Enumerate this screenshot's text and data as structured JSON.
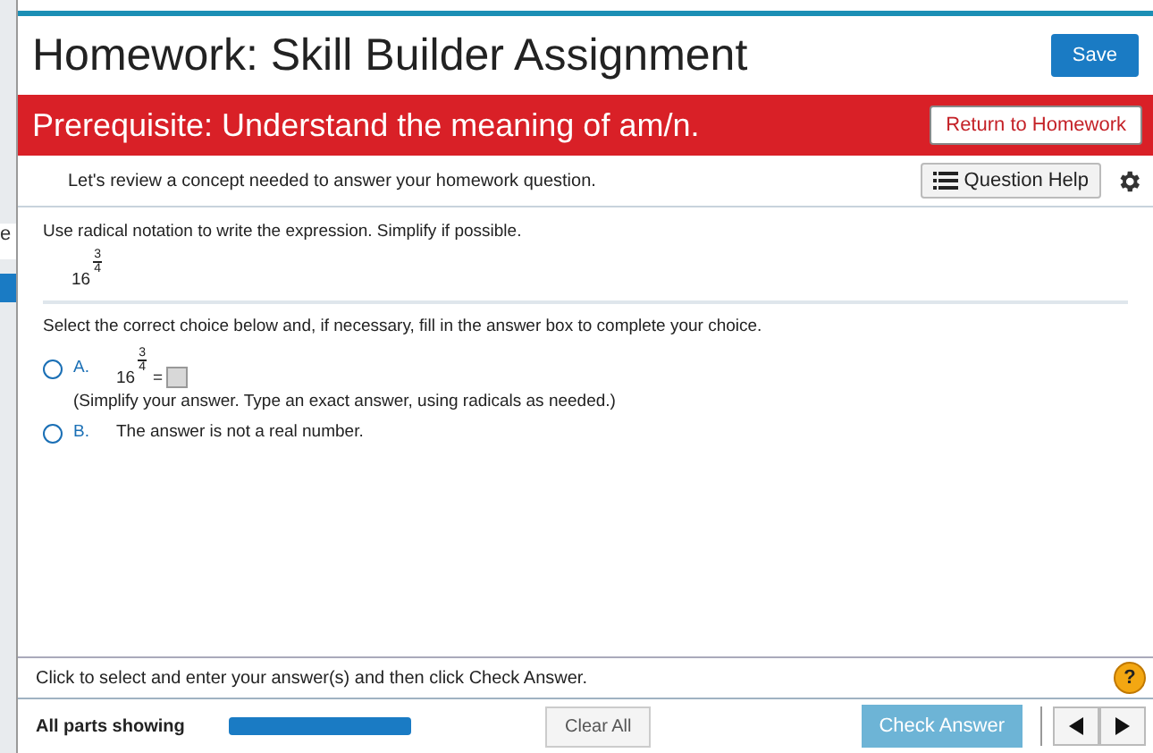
{
  "background_window": {
    "text": "e"
  },
  "header": {
    "title": "Homework: Skill Builder Assignment",
    "save_button": "Save"
  },
  "banner": {
    "text": "Prerequisite: Understand the meaning of am/n.",
    "button": "Return to Homework"
  },
  "toolbar": {
    "text": "Let's review a concept needed to answer your homework question.",
    "help_button": "Question Help"
  },
  "question": {
    "instruction": "Use radical notation to write the expression. Simplify if possible.",
    "base": "16",
    "numerator": "3",
    "denominator": "4",
    "prompt": "Select the correct choice below and, if necessary, fill in the answer box to complete your choice.",
    "choices": [
      {
        "kind": "answer",
        "letter": "A.",
        "selected": false,
        "base": "16",
        "numerator": "3",
        "denominator": "4",
        "equals": "=",
        "hint": "(Simplify your answer. Type an exact answer, using radicals as needed.)"
      },
      {
        "kind": "text",
        "letter": "B.",
        "selected": false,
        "text": "The answer is not a real number."
      }
    ]
  },
  "footer": {
    "instruction": "Click to select and enter your answer(s) and then click Check Answer.",
    "help_icon": "?",
    "parts_label": "All parts showing",
    "level": 1,
    "clear_button": "Clear All",
    "check_button": "Check Answer",
    "check_disabled": true
  }
}
